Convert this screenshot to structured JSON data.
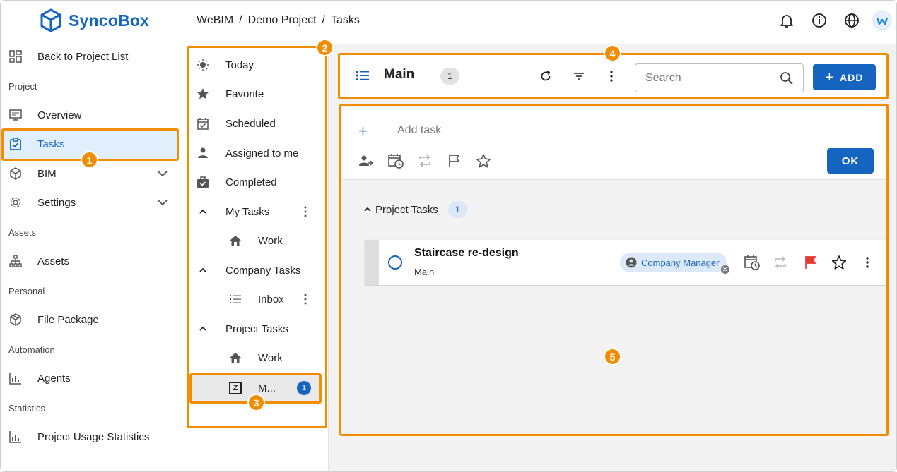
{
  "app": {
    "name": "SyncoBox"
  },
  "breadcrumb": [
    "WeBIM",
    "/",
    "Demo Project",
    "/",
    "Tasks"
  ],
  "sidebar": {
    "back": "Back to Project List",
    "sections": {
      "project": "Project",
      "assets": "Assets",
      "personal": "Personal",
      "automation": "Automation",
      "statistics": "Statistics"
    },
    "items": {
      "overview": "Overview",
      "tasks": "Tasks",
      "bim": "BIM",
      "settings": "Settings",
      "assets": "Assets",
      "file_package": "File Package",
      "agents": "Agents",
      "usage": "Project Usage Statistics"
    }
  },
  "task_lists": {
    "today": "Today",
    "favorite": "Favorite",
    "scheduled": "Scheduled",
    "assigned": "Assigned to me",
    "completed": "Completed",
    "my_tasks": "My Tasks",
    "my_work": "Work",
    "company_tasks": "Company Tasks",
    "inbox": "Inbox",
    "project_tasks": "Project Tasks",
    "project_work": "Work",
    "main_short": "M...",
    "main_icon_letter": "Z",
    "main_count": "1"
  },
  "list_header": {
    "title": "Main",
    "count": "1",
    "search_placeholder": "Search",
    "add_label": "ADD"
  },
  "add_task": {
    "placeholder": "Add task",
    "ok_label": "OK"
  },
  "group": {
    "name": "Project Tasks",
    "count": "1"
  },
  "task": {
    "title": "Staircase re-design",
    "list": "Main",
    "assignee": "Company Manager",
    "flag_color": "#e53935"
  },
  "callouts": [
    "1",
    "2",
    "3",
    "4",
    "5"
  ],
  "colors": {
    "accent": "#1565c0",
    "highlight": "#f28c00"
  }
}
